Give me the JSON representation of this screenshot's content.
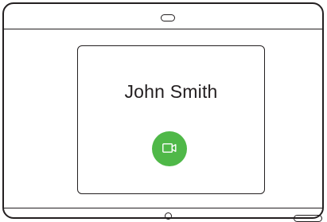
{
  "call": {
    "caller_name": "John Smith",
    "video_button_icon": "video-camera-icon"
  },
  "colors": {
    "accent": "#4fb848",
    "outline": "#231f20"
  }
}
